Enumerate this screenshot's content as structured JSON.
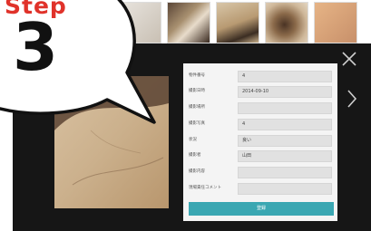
{
  "step": {
    "word": "Step",
    "number": "3"
  },
  "icons": {
    "close": "close-icon",
    "next": "chevron-right-icon"
  },
  "colors": {
    "accent": "#3aa7b2",
    "step_red": "#e0322a",
    "overlay": "#161616"
  },
  "form": {
    "rows": [
      {
        "label": "物件番号",
        "value": "4"
      },
      {
        "label": "撮影日時",
        "value": "2014-09-10"
      },
      {
        "label": "撮影場所",
        "value": ""
      },
      {
        "label": "撮影写真",
        "value": "4"
      },
      {
        "label": "状況",
        "value": "良い"
      },
      {
        "label": "撮影者",
        "value": "山田"
      },
      {
        "label": "撮影内容",
        "value": ""
      },
      {
        "label": "現場責任コメント",
        "value": ""
      }
    ],
    "submit_label": "登録"
  }
}
